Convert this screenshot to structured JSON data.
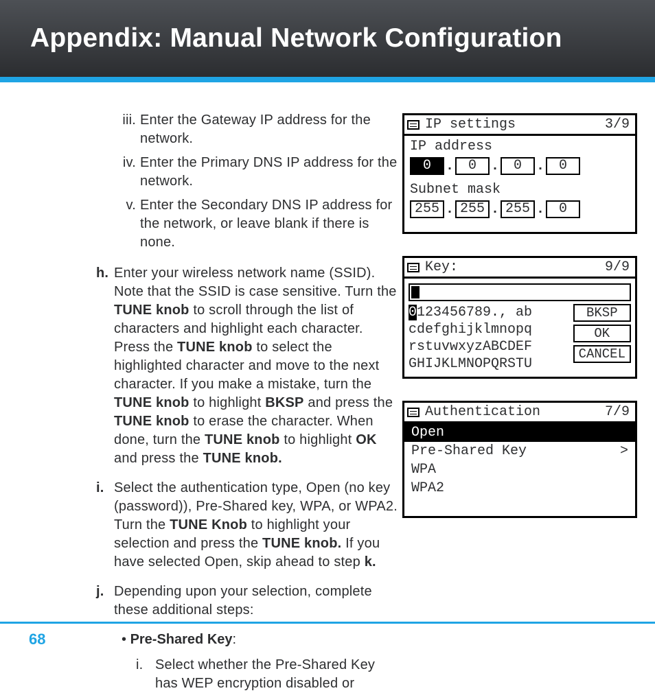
{
  "title": "Appendix: Manual Network Configuration",
  "page_number": "68",
  "roman": {
    "iii": {
      "num": "iii.",
      "text": "Enter the Gateway IP address for the network."
    },
    "iv": {
      "num": "iv.",
      "text": "Enter the Primary DNS IP address for the network."
    },
    "v": {
      "num": "v.",
      "text": "Enter the Secondary DNS IP address for the network, or leave blank if there is none."
    }
  },
  "steps": {
    "h": {
      "letter": "h.",
      "t1": "Enter your wireless network name (SSID). Note that the SSID is case sensitive. Turn the ",
      "k1": "TUNE knob",
      "t2": " to scroll through the list of characters and highlight each character. Press the ",
      "k2": "TUNE knob",
      "t3": " to select the highlighted character and move to the next character. If you make a mistake, turn the ",
      "k3": "TUNE knob",
      "t4": " to highlight ",
      "k4": "BKSP",
      "t5": " and press the ",
      "k5": "TUNE knob",
      "t6": " to erase the character. When done, turn the ",
      "k6": "TUNE knob",
      "t7": " to highlight ",
      "k7": "OK",
      "t8": " and press the ",
      "k8": "TUNE knob."
    },
    "i": {
      "letter": "i.",
      "t1": "Select the authentication type, Open (no key (password)), Pre-Shared key, WPA, or WPA2. Turn the ",
      "k1": "TUNE Knob",
      "t2": " to highlight your selection and press the ",
      "k2": "TUNE knob.",
      "t3": " If you have selected Open, skip ahead to step ",
      "k3": "k."
    },
    "j": {
      "letter": "j.",
      "text": "Depending upon your selection, complete these additional steps:"
    }
  },
  "bullet": {
    "bdot": "• ",
    "label": "Pre-Shared Key",
    "colon": ":",
    "i_num": "i.",
    "i_text": "Select whether the Pre-Shared Key has WEP encryption disabled or"
  },
  "screen1": {
    "title": "IP settings",
    "page": "3/9",
    "label1": "IP address",
    "ip": [
      "0",
      "0",
      "0",
      "0"
    ],
    "label2": "Subnet mask",
    "mask": [
      "255",
      "255",
      "255",
      "0"
    ]
  },
  "screen2": {
    "title": "Key:",
    "page": "9/9",
    "line1a": "0",
    "line1b": "123456789., ab",
    "line2": "cdefghijklmnopq",
    "line3": "rstuvwxyzABCDEF",
    "line4": "GHIJKLMNOPQRSTU",
    "btns": {
      "bksp": "BKSP",
      "ok": "OK",
      "cancel": "CANCEL"
    }
  },
  "screen3": {
    "title": "Authentication",
    "page": "7/9",
    "opts": {
      "open": "Open",
      "psk": "Pre-Shared Key",
      "wpa": "WPA",
      "wpa2": "WPA2"
    },
    "arrow": ">"
  }
}
